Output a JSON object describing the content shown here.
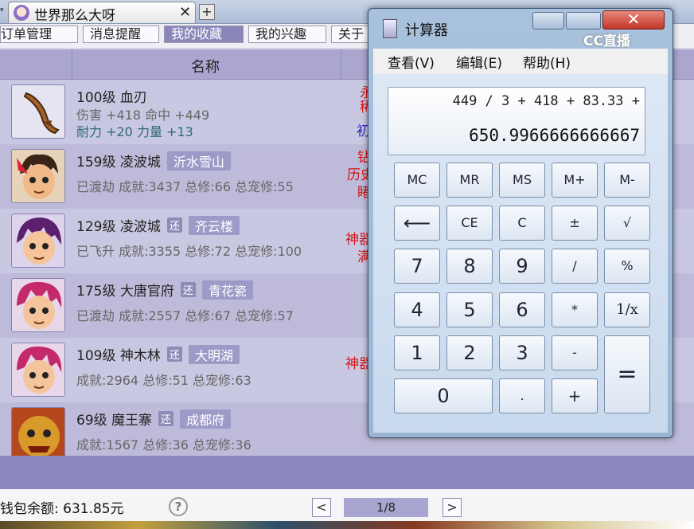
{
  "browser": {
    "tab_title": "世界那么大呀",
    "tab_close": "✕",
    "new_tab": "+",
    "tab_arrow": "▾"
  },
  "nav_tabs": [
    "订单管理",
    "消息提醒",
    "我的收藏",
    "我的兴趣",
    "关于"
  ],
  "table": {
    "column_name": "名称"
  },
  "rows": [
    {
      "level_name": "100级 血刃",
      "line2a": "伤害 +418 命中 +449",
      "line3": "耐力 +20 力量 +13",
      "right_red": "永\n稀",
      "right_blue": "初"
    },
    {
      "level_name": "159级 凌波城",
      "server": "沂水雪山",
      "line2": "已渡劫 成就:3437 总修:66 总宠修:55",
      "right_red": "钻\n历史\n睹"
    },
    {
      "level_name": "129级 凌波城",
      "badge": "还",
      "server": "齐云楼",
      "line2": "已飞升 成就:3355 总修:72 总宠修:100",
      "right_red": "神器\n满"
    },
    {
      "level_name": "175级 大唐官府",
      "badge": "还",
      "server": "青花瓷",
      "line2": "已渡劫 成就:2557 总修:67 总宠修:57"
    },
    {
      "level_name": "109级 神木林",
      "badge": "还",
      "server": "大明湖",
      "line2": "成就:2964 总修:51 总宠修:63",
      "right_red": "神器"
    },
    {
      "level_name": "69级 魔王寨",
      "badge": "还",
      "server": "成都府",
      "line2": "成就:1567 总修:36 总宠修:36"
    }
  ],
  "footer": {
    "wallet": "钱包余额: 631.85元",
    "help": "?",
    "prev": "<",
    "page": "1/8",
    "next": ">"
  },
  "calculator": {
    "title": "计算器",
    "close": "✕",
    "watermark": "CC直播",
    "menu": [
      "查看(V)",
      "编辑(E)",
      "帮助(H)"
    ],
    "expression": "449 / 3 + 418 + 83.33 +",
    "result": "650.9966666666667",
    "buttons": {
      "mc": "MC",
      "mr": "MR",
      "ms": "MS",
      "mplus": "M+",
      "mminus": "M-",
      "back": "⟵",
      "ce": "CE",
      "c": "C",
      "pm": "±",
      "sqrt": "√",
      "d7": "7",
      "d8": "8",
      "d9": "9",
      "div": "/",
      "pct": "%",
      "d4": "4",
      "d5": "5",
      "d6": "6",
      "mul": "*",
      "inv": "1/x",
      "d1": "1",
      "d2": "2",
      "d3": "3",
      "sub": "-",
      "eq": "=",
      "d0": "0",
      "dot": ".",
      "add": "+"
    }
  }
}
